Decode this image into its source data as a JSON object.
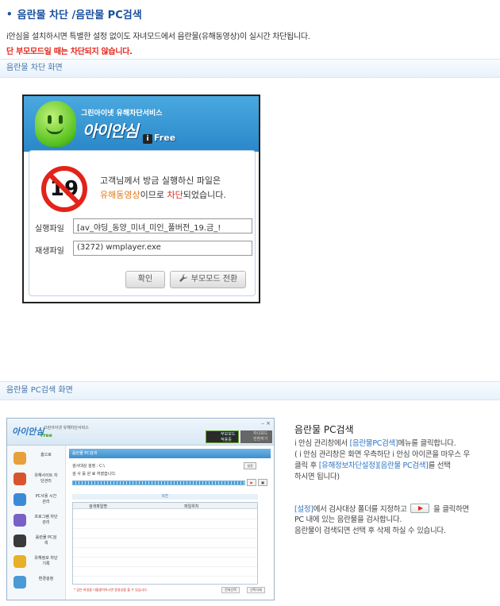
{
  "header": {
    "title": "음란물 차단 /음란물 PC검색",
    "description": "i안심을 설치하시면 특별한 설정 없이도 자녀모드에서 음란물(유해동영상)이 실시간 차단됩니다.",
    "warning": "단 부모모드일 때는 차단되지 않습니다."
  },
  "section1": {
    "label": "음란물 차단 화면",
    "dialog": {
      "service_name": "그린아이넷 유해차단서비스",
      "brand": "아이안심",
      "brand_free": "Free",
      "brand_badge": "i",
      "sign_text": "19",
      "message_line1": "고객님께서 방금 실행하신 파일은",
      "message_hl1": "유해동영상",
      "message_mid": "이므로 ",
      "message_hl2": "차단",
      "message_end": "되었습니다.",
      "file_label": "실행파일",
      "file_value": "[av_야딩_동양_미녀_미인_풀버전_19.금_!",
      "player_label": "재생파일",
      "player_value": "(3272) wmplayer.exe",
      "ok_button": "확인",
      "parent_mode_button": "부모모드 전환"
    }
  },
  "section2": {
    "label": "음란물 PC검색 화면",
    "app": {
      "logo": "아이안심",
      "logo_sub": "그린아이넷 유해차단서비스",
      "logo_free": "Free",
      "close": "– ×",
      "mode_parent": "부모모드 적용중",
      "mode_child": "자녀모드 전환하기",
      "menu": [
        {
          "label": "홈으로",
          "color": "#e8a03a"
        },
        {
          "label": "유해사이트 차단관리",
          "color": "#d9532c"
        },
        {
          "label": "PC사용 시간관리",
          "color": "#3a8ad8"
        },
        {
          "label": "프로그램 차단관리",
          "color": "#7a62c4"
        },
        {
          "label": "음란물 PC검색",
          "color": "#3a3a3a"
        },
        {
          "label": "유해정보 차단기록",
          "color": "#e8b028"
        },
        {
          "label": "환경설정",
          "color": "#4a9ad6"
        }
      ],
      "panel_title": "음란물 PC검색",
      "scan_target_label": "검사대상 설정 : C:\\",
      "settings_button": "설정",
      "status_text": "검 사 를  완 료  하였습니다.",
      "count_text": "0건",
      "col_name": "검색파일명",
      "col_location": "파일위치",
      "footer_note": "* 검은 파일을 더블클릭하시면 동영상을 볼 수 있습니다.",
      "select_all": "전체선택",
      "select_delete": "선택삭제"
    }
  },
  "right": {
    "title": "음란물 PC검색",
    "p1_a": "i 안심 관리창에서 ",
    "p1_link": "[음란물PC검색]",
    "p1_b": "메뉴를 클릭합니다.",
    "p2": "( i 안심 관리창은 화면 우측하단  i 안심 아이콘을 마우스 우",
    "p3_a": "클릭 후 ",
    "p3_link": "[유해정보차단설정][음란물 PC검색]",
    "p3_b": "를 선택",
    "p4": "하시면 됩니다)",
    "p5_link": "[설정]",
    "p5_a": "에서 검사대상 폴더를 지정하고 ",
    "p5_b": " 을 클릭하면",
    "p6": "PC 내에 있는 음란물을 검사합니다.",
    "p7": "음란물이 검색되면 선택 후 삭제 하실 수 있습니다."
  }
}
